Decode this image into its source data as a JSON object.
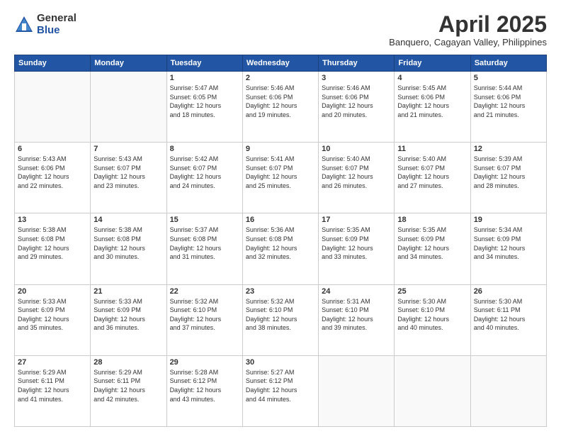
{
  "header": {
    "logo_general": "General",
    "logo_blue": "Blue",
    "month_title": "April 2025",
    "subtitle": "Banquero, Cagayan Valley, Philippines"
  },
  "days_of_week": [
    "Sunday",
    "Monday",
    "Tuesday",
    "Wednesday",
    "Thursday",
    "Friday",
    "Saturday"
  ],
  "weeks": [
    [
      {
        "day": "",
        "info": ""
      },
      {
        "day": "",
        "info": ""
      },
      {
        "day": "1",
        "info": "Sunrise: 5:47 AM\nSunset: 6:05 PM\nDaylight: 12 hours\nand 18 minutes."
      },
      {
        "day": "2",
        "info": "Sunrise: 5:46 AM\nSunset: 6:06 PM\nDaylight: 12 hours\nand 19 minutes."
      },
      {
        "day": "3",
        "info": "Sunrise: 5:46 AM\nSunset: 6:06 PM\nDaylight: 12 hours\nand 20 minutes."
      },
      {
        "day": "4",
        "info": "Sunrise: 5:45 AM\nSunset: 6:06 PM\nDaylight: 12 hours\nand 21 minutes."
      },
      {
        "day": "5",
        "info": "Sunrise: 5:44 AM\nSunset: 6:06 PM\nDaylight: 12 hours\nand 21 minutes."
      }
    ],
    [
      {
        "day": "6",
        "info": "Sunrise: 5:43 AM\nSunset: 6:06 PM\nDaylight: 12 hours\nand 22 minutes."
      },
      {
        "day": "7",
        "info": "Sunrise: 5:43 AM\nSunset: 6:07 PM\nDaylight: 12 hours\nand 23 minutes."
      },
      {
        "day": "8",
        "info": "Sunrise: 5:42 AM\nSunset: 6:07 PM\nDaylight: 12 hours\nand 24 minutes."
      },
      {
        "day": "9",
        "info": "Sunrise: 5:41 AM\nSunset: 6:07 PM\nDaylight: 12 hours\nand 25 minutes."
      },
      {
        "day": "10",
        "info": "Sunrise: 5:40 AM\nSunset: 6:07 PM\nDaylight: 12 hours\nand 26 minutes."
      },
      {
        "day": "11",
        "info": "Sunrise: 5:40 AM\nSunset: 6:07 PM\nDaylight: 12 hours\nand 27 minutes."
      },
      {
        "day": "12",
        "info": "Sunrise: 5:39 AM\nSunset: 6:07 PM\nDaylight: 12 hours\nand 28 minutes."
      }
    ],
    [
      {
        "day": "13",
        "info": "Sunrise: 5:38 AM\nSunset: 6:08 PM\nDaylight: 12 hours\nand 29 minutes."
      },
      {
        "day": "14",
        "info": "Sunrise: 5:38 AM\nSunset: 6:08 PM\nDaylight: 12 hours\nand 30 minutes."
      },
      {
        "day": "15",
        "info": "Sunrise: 5:37 AM\nSunset: 6:08 PM\nDaylight: 12 hours\nand 31 minutes."
      },
      {
        "day": "16",
        "info": "Sunrise: 5:36 AM\nSunset: 6:08 PM\nDaylight: 12 hours\nand 32 minutes."
      },
      {
        "day": "17",
        "info": "Sunrise: 5:35 AM\nSunset: 6:09 PM\nDaylight: 12 hours\nand 33 minutes."
      },
      {
        "day": "18",
        "info": "Sunrise: 5:35 AM\nSunset: 6:09 PM\nDaylight: 12 hours\nand 34 minutes."
      },
      {
        "day": "19",
        "info": "Sunrise: 5:34 AM\nSunset: 6:09 PM\nDaylight: 12 hours\nand 34 minutes."
      }
    ],
    [
      {
        "day": "20",
        "info": "Sunrise: 5:33 AM\nSunset: 6:09 PM\nDaylight: 12 hours\nand 35 minutes."
      },
      {
        "day": "21",
        "info": "Sunrise: 5:33 AM\nSunset: 6:09 PM\nDaylight: 12 hours\nand 36 minutes."
      },
      {
        "day": "22",
        "info": "Sunrise: 5:32 AM\nSunset: 6:10 PM\nDaylight: 12 hours\nand 37 minutes."
      },
      {
        "day": "23",
        "info": "Sunrise: 5:32 AM\nSunset: 6:10 PM\nDaylight: 12 hours\nand 38 minutes."
      },
      {
        "day": "24",
        "info": "Sunrise: 5:31 AM\nSunset: 6:10 PM\nDaylight: 12 hours\nand 39 minutes."
      },
      {
        "day": "25",
        "info": "Sunrise: 5:30 AM\nSunset: 6:10 PM\nDaylight: 12 hours\nand 40 minutes."
      },
      {
        "day": "26",
        "info": "Sunrise: 5:30 AM\nSunset: 6:11 PM\nDaylight: 12 hours\nand 40 minutes."
      }
    ],
    [
      {
        "day": "27",
        "info": "Sunrise: 5:29 AM\nSunset: 6:11 PM\nDaylight: 12 hours\nand 41 minutes."
      },
      {
        "day": "28",
        "info": "Sunrise: 5:29 AM\nSunset: 6:11 PM\nDaylight: 12 hours\nand 42 minutes."
      },
      {
        "day": "29",
        "info": "Sunrise: 5:28 AM\nSunset: 6:12 PM\nDaylight: 12 hours\nand 43 minutes."
      },
      {
        "day": "30",
        "info": "Sunrise: 5:27 AM\nSunset: 6:12 PM\nDaylight: 12 hours\nand 44 minutes."
      },
      {
        "day": "",
        "info": ""
      },
      {
        "day": "",
        "info": ""
      },
      {
        "day": "",
        "info": ""
      }
    ]
  ]
}
